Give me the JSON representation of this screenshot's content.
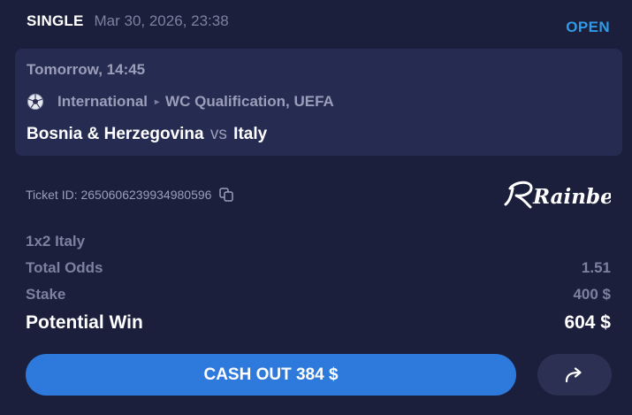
{
  "header": {
    "bet_type": "SINGLE",
    "date": "Mar 30, 2026, 23:38",
    "status": "OPEN"
  },
  "event": {
    "time": "Tomorrow, 14:45",
    "sport_icon": "soccer-ball-icon",
    "category": "International",
    "separator": "▸",
    "competition": "WC Qualification, UEFA",
    "home": "Bosnia & Herzegovina",
    "vs": "vs",
    "away": "Italy"
  },
  "ticket": {
    "id_text": "Ticket ID: 2650606239934980596",
    "copy_icon": "copy-icon"
  },
  "brand": {
    "logo_text": "Rainbet"
  },
  "details": {
    "selection": "1x2 Italy",
    "odds_label": "Total Odds",
    "odds_value": "1.51",
    "stake_label": "Stake",
    "stake_value": "400 $",
    "win_label": "Potential Win",
    "win_value": "604 $"
  },
  "actions": {
    "cashout_label": "CASH OUT 384 $",
    "share_icon": "share-arrow-icon"
  },
  "colors": {
    "card_bg": "#1b1f3b",
    "event_bg": "#262b52",
    "accent": "#2e7adc",
    "status": "#2f9be8"
  }
}
